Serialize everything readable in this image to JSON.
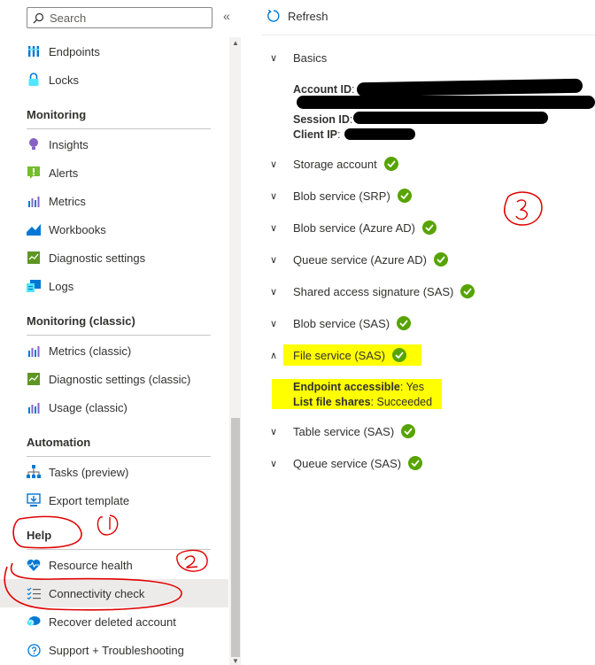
{
  "sidebar": {
    "search_placeholder": "Search",
    "collapse_icon": "«",
    "items": [
      {
        "label": "Endpoints",
        "icon": "endpoints-icon"
      },
      {
        "label": "Locks",
        "icon": "lock-icon"
      },
      {
        "label": "Insights",
        "icon": "insights-icon"
      },
      {
        "label": "Alerts",
        "icon": "alerts-icon"
      },
      {
        "label": "Metrics",
        "icon": "metrics-icon"
      },
      {
        "label": "Workbooks",
        "icon": "workbooks-icon"
      },
      {
        "label": "Diagnostic settings",
        "icon": "diagnostic-settings-icon"
      },
      {
        "label": "Logs",
        "icon": "logs-icon"
      },
      {
        "label": "Metrics (classic)",
        "icon": "metrics-icon"
      },
      {
        "label": "Diagnostic settings (classic)",
        "icon": "diagnostic-settings-icon"
      },
      {
        "label": "Usage (classic)",
        "icon": "metrics-icon"
      },
      {
        "label": "Tasks (preview)",
        "icon": "tasks-icon"
      },
      {
        "label": "Export template",
        "icon": "export-template-icon"
      },
      {
        "label": "Resource health",
        "icon": "heart-icon"
      },
      {
        "label": "Connectivity check",
        "icon": "checklist-icon",
        "selected": true
      },
      {
        "label": "Recover deleted account",
        "icon": "recover-icon"
      },
      {
        "label": "Support + Troubleshooting",
        "icon": "help-icon"
      }
    ],
    "sections": [
      "Monitoring",
      "Monitoring (classic)",
      "Automation",
      "Help"
    ]
  },
  "toolbar": {
    "refresh_label": "Refresh"
  },
  "results": {
    "basics": {
      "label": "Basics",
      "account_id_label": "Account ID",
      "session_id_label": "Session ID",
      "client_ip_label": "Client IP"
    },
    "checks": [
      {
        "label": "Storage account",
        "expanded": false
      },
      {
        "label": "Blob service (SRP)",
        "expanded": false
      },
      {
        "label": "Blob service (Azure AD)",
        "expanded": false
      },
      {
        "label": "Queue service (Azure AD)",
        "expanded": false
      },
      {
        "label": "Shared access signature (SAS)",
        "expanded": false
      },
      {
        "label": "Blob service (SAS)",
        "expanded": false
      },
      {
        "label": "File service (SAS)",
        "expanded": true
      },
      {
        "label": "Table service (SAS)",
        "expanded": false
      },
      {
        "label": "Queue service (SAS)",
        "expanded": false
      }
    ],
    "file_service_details": {
      "endpoint_label": "Endpoint accessible",
      "endpoint_value": "Yes",
      "list_label": "List file shares",
      "list_value": "Succeeded"
    },
    "status_color": "#57a300"
  },
  "annotations": {
    "highlight_color": "#ffff00",
    "ink_color": "#e00000"
  }
}
